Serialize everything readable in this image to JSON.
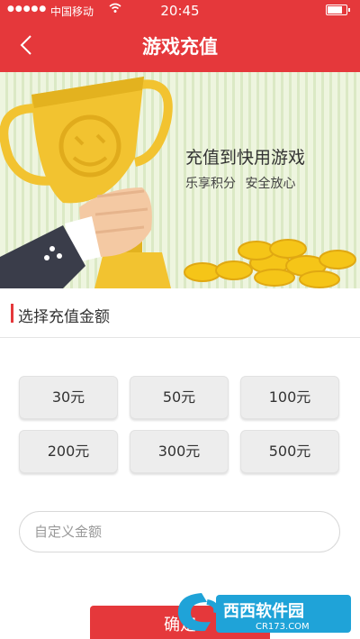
{
  "status_bar": {
    "signal": "●●●●●",
    "carrier": "中国移动",
    "time": "20:45"
  },
  "header": {
    "title": "游戏充值"
  },
  "banner": {
    "title": "充值到快用游戏",
    "subtitle": "乐享积分 安全放心"
  },
  "section": {
    "title": "选择充值金额"
  },
  "amounts": [
    "30元",
    "50元",
    "100元",
    "200元",
    "300元",
    "500元"
  ],
  "custom_amount": {
    "placeholder": "自定义金额"
  },
  "confirm_label": "确定",
  "watermark": {
    "text": "西西软件园",
    "url": "CR173.COM"
  },
  "colors": {
    "accent": "#e5383b",
    "trophy": "#f2c330",
    "coin": "#f5c518"
  }
}
